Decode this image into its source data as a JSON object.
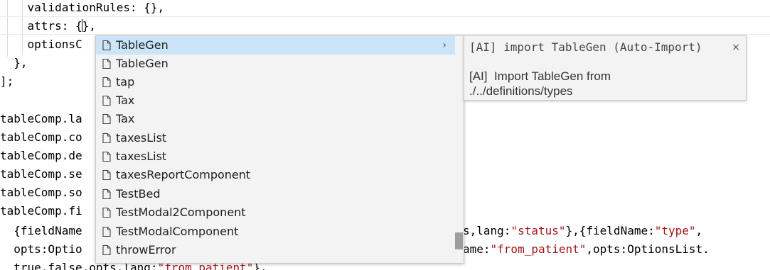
{
  "editor": {
    "line1": "    validationRules: {},",
    "line2_pre": "    attrs: {",
    "line2_post": "},",
    "line3": "    optionsC",
    "line4": "  },",
    "line5": "];",
    "line6": "tableComp.la",
    "line7": "tableComp.co",
    "line8": "tableComp.de",
    "line9": "tableComp.se",
    "line10": "tableComp.so",
    "line11": "tableComp.fi",
    "line12_pre": "  {fieldName",
    "line12_right_a": "s,lang:",
    "line12_right_str1": "\"status\"",
    "line12_right_b": "},{fieldName:",
    "line12_right_str2": "\"type\"",
    "line12_right_c": ",",
    "line13_pre": "  opts:Optio",
    "line13_right_a": "ame:",
    "line13_right_str": "\"from_patient\"",
    "line13_right_b": ",opts:OptionsList.",
    "line14_pre": "  true,false,opts,lang:",
    "line14_str": "\"from_patient\"",
    "line14_post": "},"
  },
  "suggest": {
    "more_glyph": "›",
    "items": [
      {
        "label": "TableGen",
        "icon": "document-icon"
      },
      {
        "label": "TableGen",
        "icon": "document-icon"
      },
      {
        "label": "tap",
        "icon": "document-icon"
      },
      {
        "label": "Tax",
        "icon": "document-icon"
      },
      {
        "label": "Tax",
        "icon": "document-icon"
      },
      {
        "label": "taxesList",
        "icon": "document-icon"
      },
      {
        "label": "taxesList",
        "icon": "document-icon"
      },
      {
        "label": "taxesReportComponent",
        "icon": "document-icon"
      },
      {
        "label": "TestBed",
        "icon": "document-icon"
      },
      {
        "label": "TestModal2Component",
        "icon": "document-icon"
      },
      {
        "label": "TestModalComponent",
        "icon": "document-icon"
      },
      {
        "label": "throwError",
        "icon": "document-icon"
      }
    ]
  },
  "details": {
    "title": "[AI] import TableGen (Auto-Import)",
    "close": "×",
    "doc_line1": "[AI]  Import TableGen from",
    "doc_line2": "./../definitions/types"
  },
  "colors": {
    "selection": "#cce4f7",
    "string": "#a31515",
    "widget_bg": "#f3f3f3"
  }
}
